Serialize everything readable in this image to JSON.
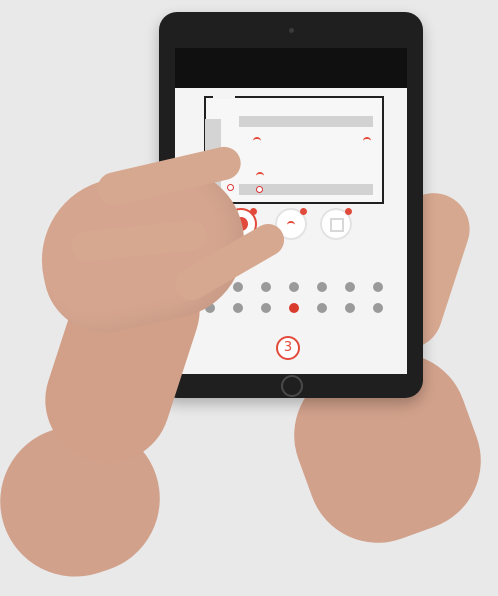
{
  "screen": {
    "step_number": "3",
    "status_caption": "",
    "colors": {
      "accent": "#e24a3b",
      "background": "#e9e9e9",
      "tablet_body": "#1f1f1f"
    },
    "buttons": [
      {
        "name": "alarm-target-button",
        "active": true
      },
      {
        "name": "signal-button",
        "active": false
      },
      {
        "name": "grid-button",
        "active": false
      }
    ],
    "dot_grid": {
      "rows": [
        [
          "red",
          "gray",
          "gray",
          "gray",
          "gray",
          "gray",
          "gray"
        ],
        [
          "gray",
          "gray",
          "gray",
          "red",
          "gray",
          "gray",
          "gray"
        ]
      ]
    }
  }
}
